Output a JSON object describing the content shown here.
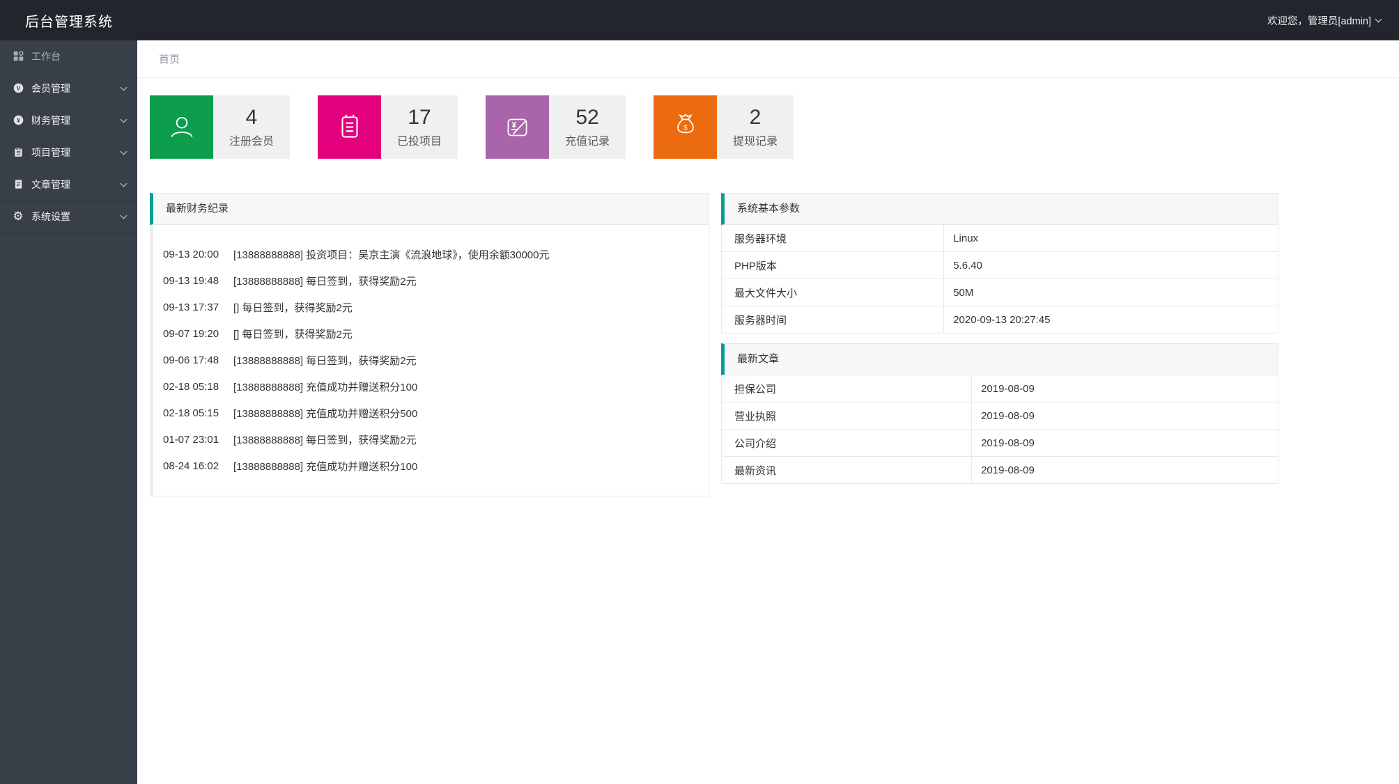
{
  "header": {
    "title": "后台管理系统",
    "user": "欢迎您，管理员[admin]"
  },
  "breadcrumb": {
    "home": "首页"
  },
  "sidebar": {
    "items": [
      {
        "label": "工作台",
        "icon": "console-icon",
        "expandable": false
      },
      {
        "label": "会员管理",
        "icon": "member-icon",
        "expandable": true
      },
      {
        "label": "财务管理",
        "icon": "finance-icon",
        "expandable": true
      },
      {
        "label": "项目管理",
        "icon": "project-icon",
        "expandable": true
      },
      {
        "label": "文章管理",
        "icon": "article-icon",
        "expandable": true
      },
      {
        "label": "系统设置",
        "icon": "gear-icon",
        "expandable": true,
        "glyph": "⚙"
      }
    ]
  },
  "stats": [
    {
      "value": "4",
      "label": "注册会员",
      "color": "#0d9e4d",
      "icon": "user-icon"
    },
    {
      "value": "17",
      "label": "已投项目",
      "color": "#e4017d",
      "icon": "clipboard-icon"
    },
    {
      "value": "52",
      "label": "充值记录",
      "color": "#a965a9",
      "icon": "recharge-icon"
    },
    {
      "value": "2",
      "label": "提现记录",
      "color": "#ec6b0e",
      "icon": "moneybag-icon"
    }
  ],
  "colors": {
    "accent_teal": "#0a9d94",
    "header_bg": "#22252c",
    "sidebar_bg": "#393f49"
  },
  "finance_panel": {
    "title": "最新财务纪录",
    "records": [
      {
        "time": "09-13 20:00",
        "text": "[13888888888] 投资项目：吴京主演《流浪地球》，使用余额30000元"
      },
      {
        "time": "09-13 19:48",
        "text": "[13888888888] 每日签到，获得奖励2元"
      },
      {
        "time": "09-13 17:37",
        "text": "[] 每日签到，获得奖励2元"
      },
      {
        "time": "09-07 19:20",
        "text": "[] 每日签到，获得奖励2元"
      },
      {
        "time": "09-06 17:48",
        "text": "[13888888888] 每日签到，获得奖励2元"
      },
      {
        "time": "02-18 05:18",
        "text": "[13888888888] 充值成功并赠送积分100"
      },
      {
        "time": "02-18 05:15",
        "text": "[13888888888] 充值成功并赠送积分500"
      },
      {
        "time": "01-07 23:01",
        "text": "[13888888888] 每日签到，获得奖励2元"
      },
      {
        "time": "08-24 16:02",
        "text": "[13888888888] 充值成功并赠送积分100"
      }
    ]
  },
  "system_panel": {
    "title": "系统基本参数",
    "rows": [
      {
        "label": "服务器环境",
        "value": "Linux"
      },
      {
        "label": "PHP版本",
        "value": "5.6.40"
      },
      {
        "label": "最大文件大小",
        "value": "50M"
      },
      {
        "label": "服务器时间",
        "value": "2020-09-13 20:27:45"
      }
    ]
  },
  "articles_panel": {
    "title": "最新文章",
    "rows": [
      {
        "label": "担保公司",
        "value": "2019-08-09"
      },
      {
        "label": "营业执照",
        "value": "2019-08-09"
      },
      {
        "label": "公司介绍",
        "value": "2019-08-09"
      },
      {
        "label": "最新资讯",
        "value": "2019-08-09"
      }
    ]
  }
}
